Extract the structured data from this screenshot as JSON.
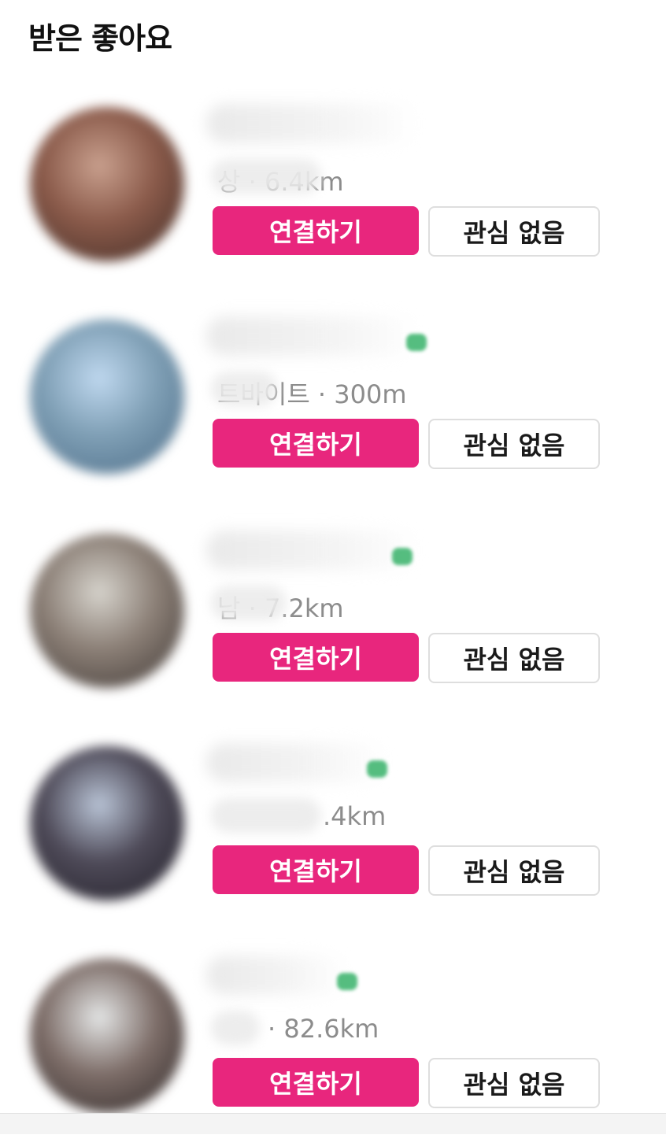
{
  "header": {
    "title": "받은 좋아요"
  },
  "likes": [
    {
      "meta": "상 · 6.4km",
      "connect_label": "연결하기",
      "dismiss_label": "관심 없음",
      "verified": false,
      "avatar_colors": [
        "#c9a08e",
        "#8a5a4a",
        "#3e2a24"
      ]
    },
    {
      "meta": "트바이트 · 300m",
      "connect_label": "연결하기",
      "dismiss_label": "관심 없음",
      "verified": true,
      "avatar_colors": [
        "#bfd8ef",
        "#7f9fb5",
        "#4a6a85"
      ]
    },
    {
      "meta": "남 · 7.2km",
      "connect_label": "연결하기",
      "dismiss_label": "관심 없음",
      "verified": true,
      "avatar_colors": [
        "#d6d3cc",
        "#8b7f76",
        "#3c3532"
      ]
    },
    {
      "meta": ".4km",
      "connect_label": "연결하기",
      "dismiss_label": "관심 없음",
      "verified": true,
      "avatar_colors": [
        "#b9c4d6",
        "#4e4a58",
        "#1f1d26"
      ]
    },
    {
      "meta": "· 82.6km",
      "connect_label": "연결하기",
      "dismiss_label": "관심 없음",
      "verified": true,
      "avatar_colors": [
        "#e4e6e6",
        "#7d6d68",
        "#2a2424"
      ]
    }
  ]
}
